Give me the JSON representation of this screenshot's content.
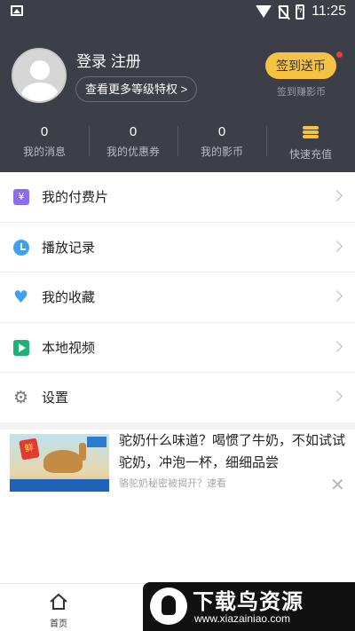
{
  "status_bar": {
    "time": "11:25"
  },
  "profile": {
    "login_register": "登录 注册",
    "privilege_link": "查看更多等级特权 >",
    "checkin_button": "签到送币",
    "checkin_subtitle": "签到赚影币"
  },
  "stats": [
    {
      "value": "0",
      "label": "我的消息"
    },
    {
      "value": "0",
      "label": "我的优惠券"
    },
    {
      "value": "0",
      "label": "我的影币"
    },
    {
      "label": "快速充值",
      "icon": "coins-icon"
    }
  ],
  "menu": [
    {
      "label": "我的付费片",
      "icon": "yen-icon"
    },
    {
      "label": "播放记录",
      "icon": "clock-icon"
    },
    {
      "label": "我的收藏",
      "icon": "heart-icon"
    },
    {
      "label": "本地视频",
      "icon": "play-icon"
    },
    {
      "label": "设置",
      "icon": "gear-icon"
    }
  ],
  "ad": {
    "title": "驼奶什么味道？喝惯了牛奶，不如试试驼奶，冲泡一杯，细细品尝",
    "subtitle": "骆驼奶秘密被揭开？速看",
    "image_tag": "鲜"
  },
  "bottom_nav": {
    "home_label": "首页"
  },
  "watermark": {
    "title": "下载鸟资源",
    "url": "www.xiazainiao.com"
  },
  "colors": {
    "header_bg": "#3c3e48",
    "accent_gold": "#f5c243",
    "notify_dot": "#e8402f"
  }
}
